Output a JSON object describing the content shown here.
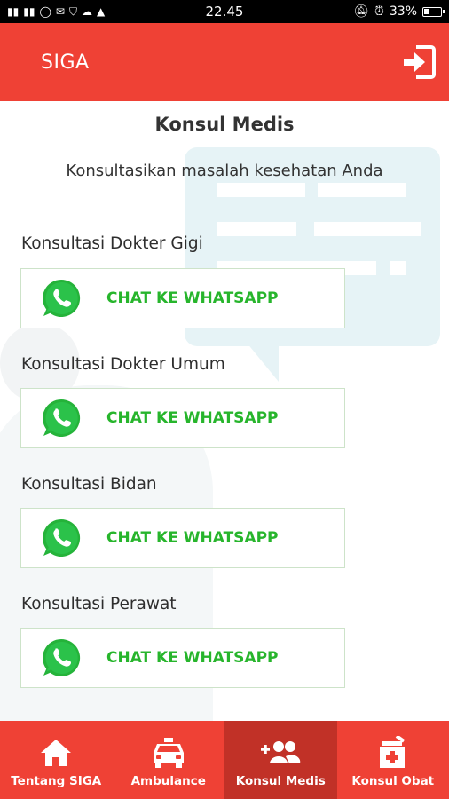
{
  "status_bar": {
    "time": "22.45",
    "battery": "33%"
  },
  "app_bar": {
    "title": "SIGA"
  },
  "page": {
    "title": "Konsul Medis",
    "subtitle": "Konsultasikan masalah kesehatan Anda"
  },
  "consultations": [
    {
      "label": "Konsultasi Dokter Gigi",
      "button": "CHAT KE WHATSAPP"
    },
    {
      "label": "Konsultasi Dokter Umum",
      "button": "CHAT KE WHATSAPP"
    },
    {
      "label": "Konsultasi Bidan",
      "button": "CHAT KE WHATSAPP"
    },
    {
      "label": "Konsultasi Perawat",
      "button": "CHAT KE WHATSAPP"
    }
  ],
  "bottom_nav": [
    {
      "label": "Tentang SIGA",
      "icon": "home-icon",
      "active": false
    },
    {
      "label": "Ambulance",
      "icon": "ambulance-icon",
      "active": false
    },
    {
      "label": "Konsul Medis",
      "icon": "add-user-icon",
      "active": true
    },
    {
      "label": "Konsul Obat",
      "icon": "medicine-icon",
      "active": false
    }
  ],
  "colors": {
    "primary": "#ef4135",
    "primary_dark": "#c13127",
    "whatsapp_green": "#27b52c"
  }
}
